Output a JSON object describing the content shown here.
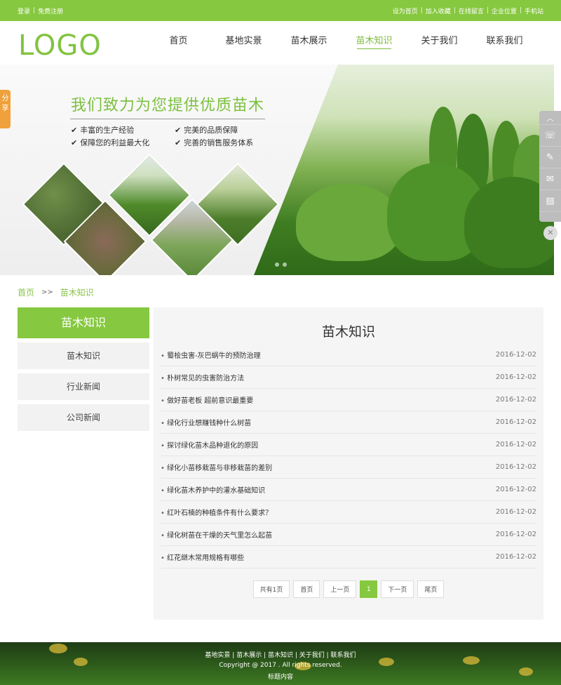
{
  "topbar": {
    "left": [
      "登录",
      "免费注册"
    ],
    "right": [
      "设为首页",
      "加入收藏",
      "在线留言",
      "企业位置",
      "手机站"
    ]
  },
  "header": {
    "logo": "LOGO",
    "nav": [
      "首页",
      "基地实景",
      "苗木展示",
      "苗木知识",
      "关于我们",
      "联系我们"
    ],
    "active": "苗木知识"
  },
  "banner": {
    "title": "我们致力为您提供优质苗木",
    "features": [
      "丰富的生产经验",
      "完美的品质保障",
      "保障您的利益最大化",
      "完善的销售服务体系"
    ]
  },
  "share": {
    "label": "分享"
  },
  "right_tools": [
    "chevron-up-icon",
    "phone-icon",
    "edit-icon",
    "mail-icon",
    "book-icon"
  ],
  "breadcrumb": {
    "home": "首页",
    "sep": ">>",
    "current": "苗木知识"
  },
  "sidebar": {
    "title": "苗木知识",
    "items": [
      "苗木知识",
      "行业新闻",
      "公司新闻"
    ]
  },
  "main": {
    "title": "苗木知识",
    "articles": [
      {
        "title": "蜀桧虫害-灰巴蜗牛的预防治理",
        "date": "2016-12-02"
      },
      {
        "title": "朴树常见的虫害防治方法",
        "date": "2016-12-02"
      },
      {
        "title": "做好苗老板 超前意识最重要",
        "date": "2016-12-02"
      },
      {
        "title": "绿化行业想赚钱种什么树苗",
        "date": "2016-12-02"
      },
      {
        "title": "探讨绿化苗木品种退化的原因",
        "date": "2016-12-02"
      },
      {
        "title": "绿化小苗移栽苗与非移栽苗的差别",
        "date": "2016-12-02"
      },
      {
        "title": "绿化苗木养护中的灌水基础知识",
        "date": "2016-12-02"
      },
      {
        "title": "红叶石楠的种植条件有什么要求？",
        "date": "2016-12-02"
      },
      {
        "title": "绿化树苗在干燥的天气里怎么起苗",
        "date": "2016-12-02"
      },
      {
        "title": "红花继木常用规格有哪些",
        "date": "2016-12-02"
      }
    ],
    "pager": {
      "total": "共有1页",
      "first": "首页",
      "prev": "上一页",
      "current": "1",
      "next": "下一页",
      "last": "尾页"
    }
  },
  "footer": {
    "links": [
      "基地实景",
      "苗木展示",
      "苗木知识",
      "关于我们",
      "联系我们"
    ],
    "copyright": "Copyright @ 2017 . All rights reserved.",
    "sub": "标题内容"
  },
  "colors": {
    "accent": "#86c83f",
    "share": "#f0a13b"
  }
}
